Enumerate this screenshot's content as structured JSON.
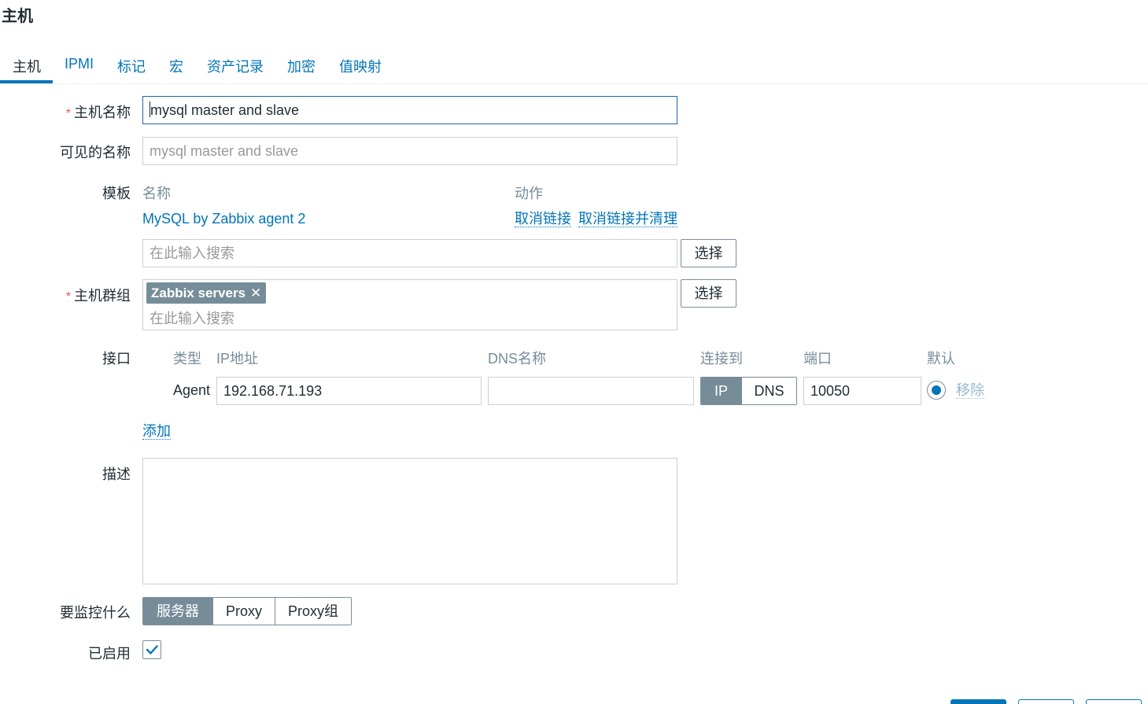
{
  "page": {
    "title": "主机"
  },
  "tabs": [
    {
      "label": "主机",
      "active": true
    },
    {
      "label": "IPMI"
    },
    {
      "label": "标记"
    },
    {
      "label": "宏"
    },
    {
      "label": "资产记录"
    },
    {
      "label": "加密"
    },
    {
      "label": "值映射"
    }
  ],
  "form": {
    "host_name": {
      "label": "主机名称",
      "required_mark": "*",
      "value": "mysql master and slave"
    },
    "visible_name": {
      "label": "可见的名称",
      "placeholder": "mysql master and slave"
    },
    "templates": {
      "label": "模板",
      "col_name": "名称",
      "col_action": "动作",
      "items": [
        {
          "name": "MySQL by Zabbix agent 2",
          "unlink": "取消链接",
          "unlink_clear": "取消链接并清理"
        }
      ],
      "search_placeholder": "在此输入搜索",
      "select_label": "选择"
    },
    "host_groups": {
      "label": "主机群组",
      "required_mark": "*",
      "tags": [
        {
          "label": "Zabbix servers",
          "remove": "✕"
        }
      ],
      "search_placeholder": "在此输入搜索",
      "select_label": "选择"
    },
    "interfaces": {
      "label": "接口",
      "headers": {
        "type": "类型",
        "ip": "IP地址",
        "dns": "DNS名称",
        "connect": "连接到",
        "port": "端口",
        "default": "默认"
      },
      "rows": [
        {
          "type": "Agent",
          "ip": "192.168.71.193",
          "dns": "",
          "connect_options": [
            "IP",
            "DNS"
          ],
          "connect_selected": "IP",
          "port": "10050",
          "default": true,
          "remove": "移除"
        }
      ],
      "add_label": "添加"
    },
    "description": {
      "label": "描述",
      "value": ""
    },
    "monitored_by": {
      "label": "要监控什么",
      "options": [
        "服务器",
        "Proxy",
        "Proxy组"
      ],
      "selected": "服务器"
    },
    "enabled": {
      "label": "已启用",
      "checked": true
    }
  },
  "colors": {
    "accent": "#0275b8",
    "segment_on": "#768d99",
    "required": "#e45959"
  }
}
